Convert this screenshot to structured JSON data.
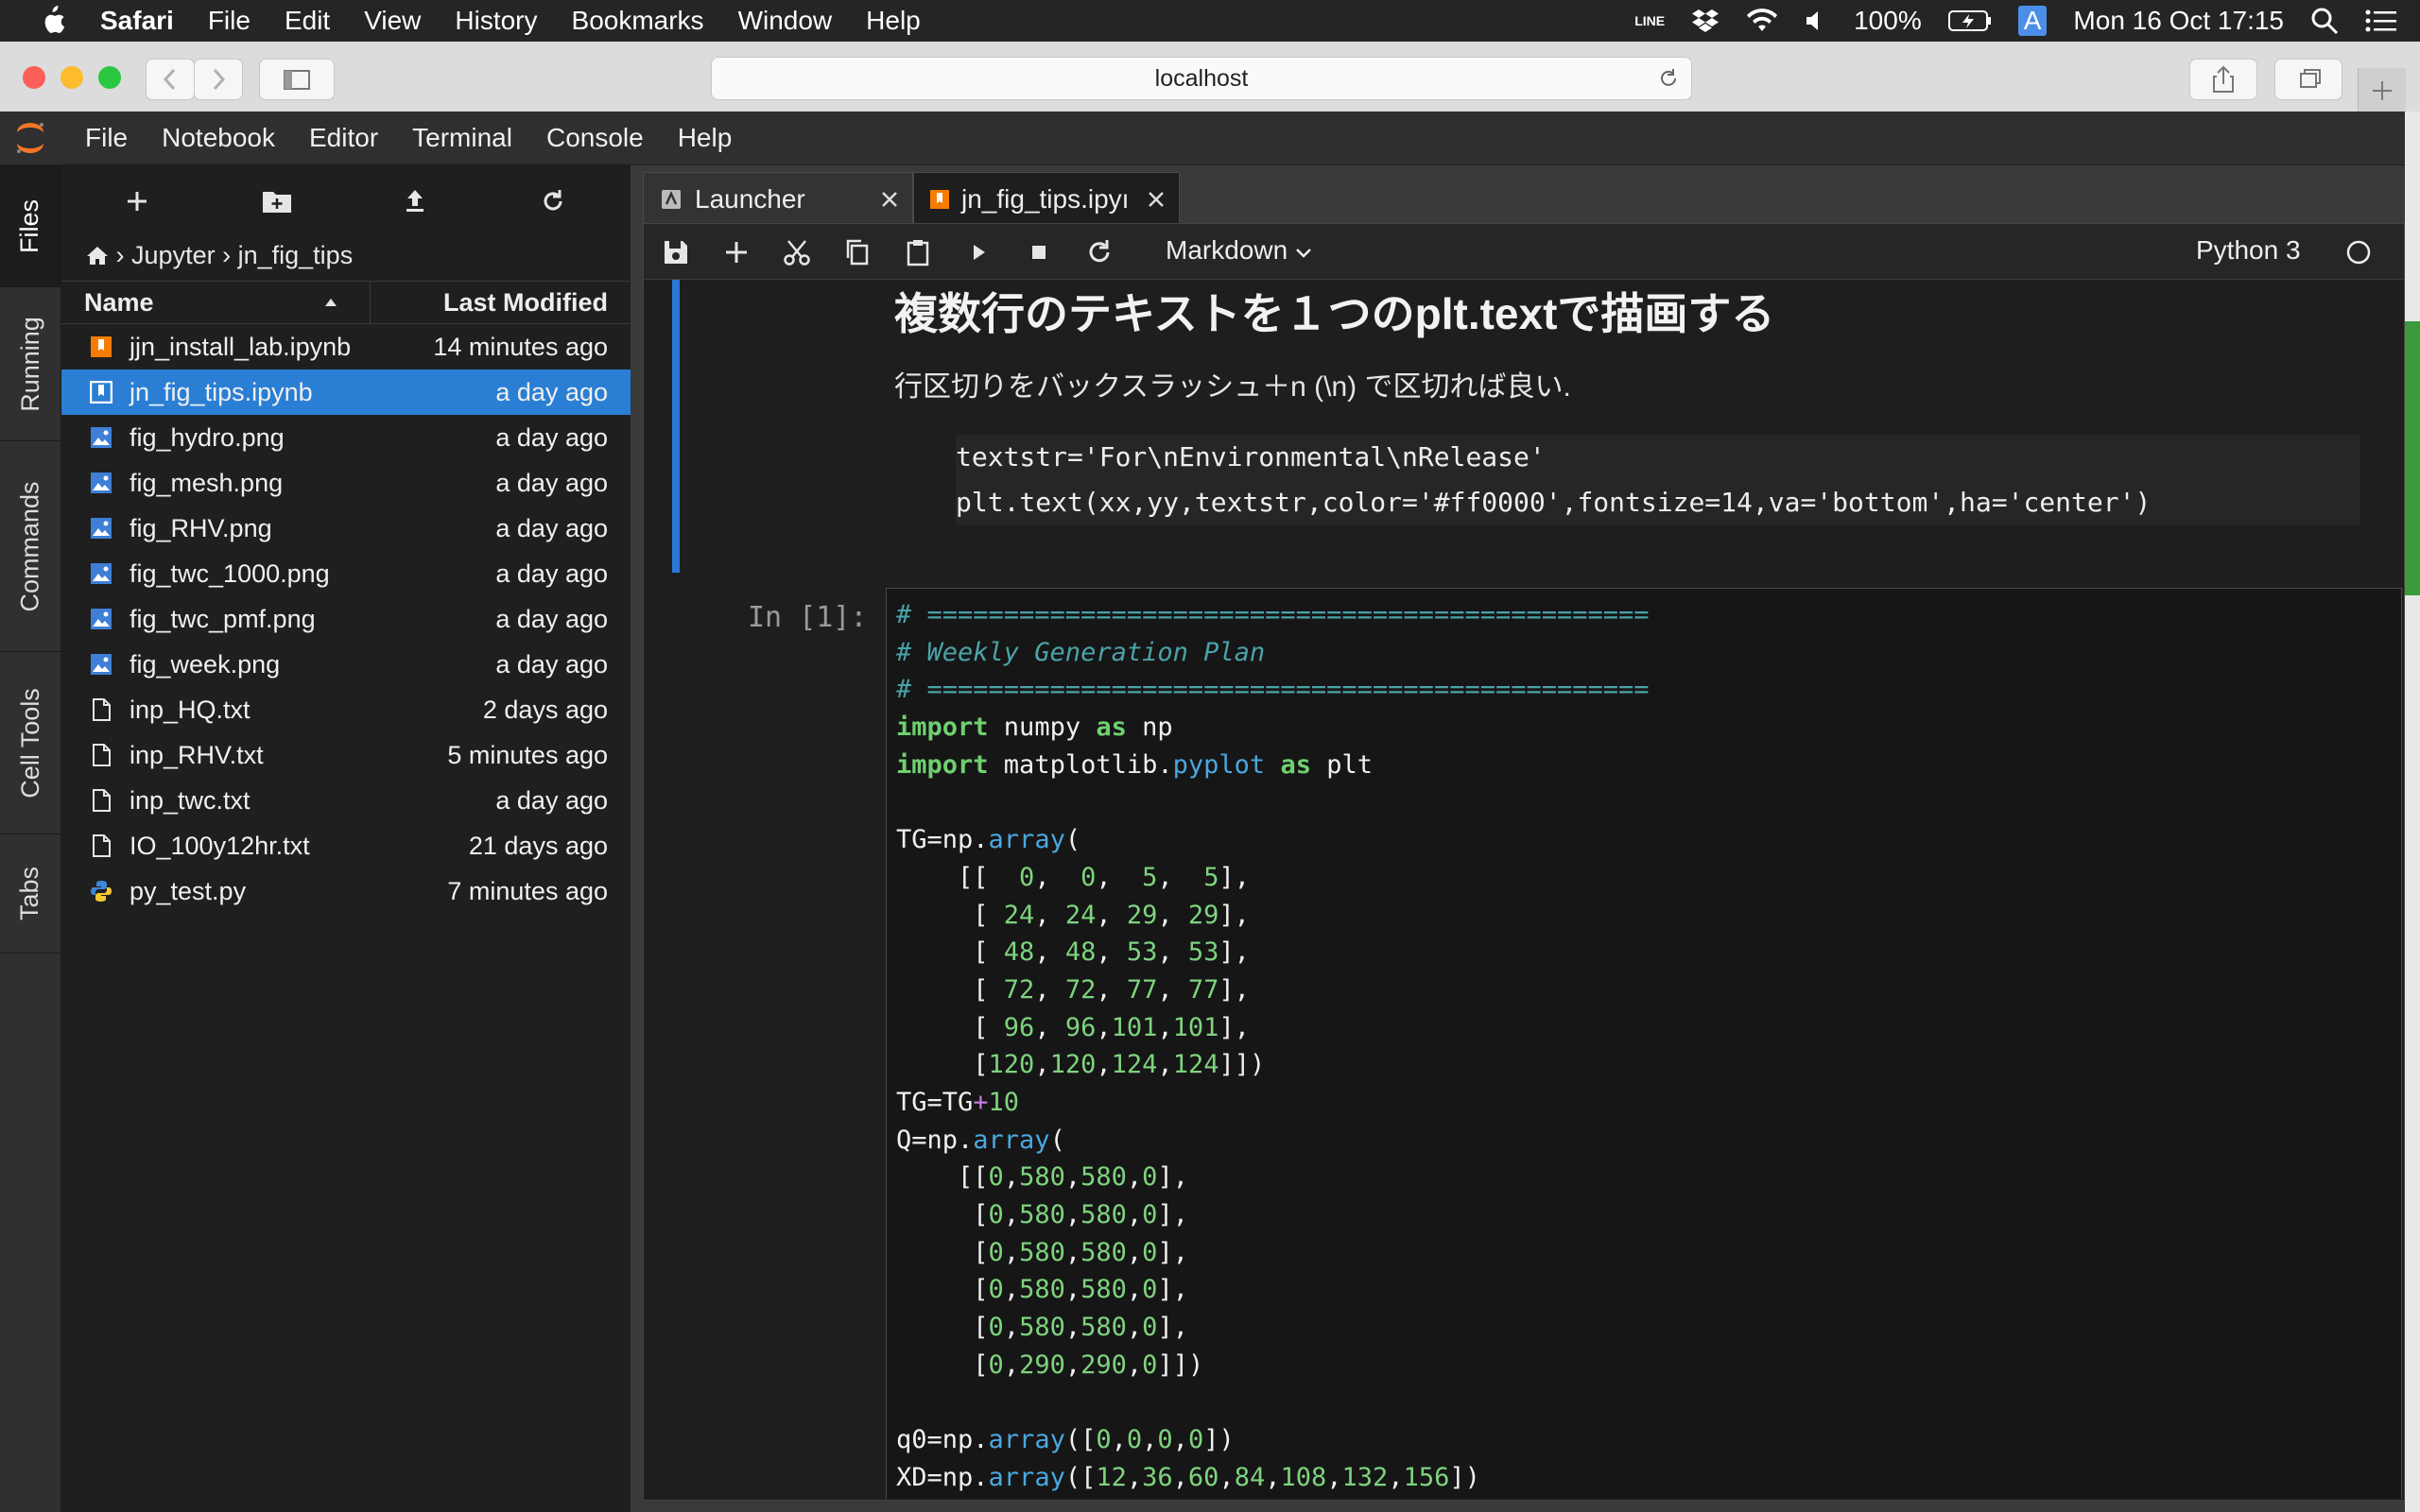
{
  "macos": {
    "app": "Safari",
    "menus": [
      "File",
      "Edit",
      "View",
      "History",
      "Bookmarks",
      "Window",
      "Help"
    ],
    "battery": "100%",
    "clock": "Mon 16 Oct  17:15",
    "line_label": "LINE",
    "input_label": "A"
  },
  "safari": {
    "url": "localhost"
  },
  "jupyter": {
    "menus": [
      "File",
      "Notebook",
      "Editor",
      "Terminal",
      "Console",
      "Help"
    ],
    "side_tabs": [
      "Files",
      "Running",
      "Commands",
      "Cell Tools",
      "Tabs"
    ],
    "breadcrumb": {
      "root": "Jupyter",
      "folder": "jn_fig_tips"
    },
    "columns": {
      "name": "Name",
      "modified": "Last Modified"
    },
    "files": [
      {
        "name": "jjn_install_lab.ipynb",
        "modified": "14 minutes ago",
        "type": "notebook"
      },
      {
        "name": "jn_fig_tips.ipynb",
        "modified": "a day ago",
        "type": "notebook",
        "selected": true
      },
      {
        "name": "fig_hydro.png",
        "modified": "a day ago",
        "type": "image"
      },
      {
        "name": "fig_mesh.png",
        "modified": "a day ago",
        "type": "image"
      },
      {
        "name": "fig_RHV.png",
        "modified": "a day ago",
        "type": "image"
      },
      {
        "name": "fig_twc_1000.png",
        "modified": "a day ago",
        "type": "image"
      },
      {
        "name": "fig_twc_pmf.png",
        "modified": "a day ago",
        "type": "image"
      },
      {
        "name": "fig_week.png",
        "modified": "a day ago",
        "type": "image"
      },
      {
        "name": "inp_HQ.txt",
        "modified": "2 days ago",
        "type": "text"
      },
      {
        "name": "inp_RHV.txt",
        "modified": "5 minutes ago",
        "type": "text"
      },
      {
        "name": "inp_twc.txt",
        "modified": "a day ago",
        "type": "text"
      },
      {
        "name": "IO_100y12hr.txt",
        "modified": "21 days ago",
        "type": "text"
      },
      {
        "name": "py_test.py",
        "modified": "7 minutes ago",
        "type": "python"
      }
    ],
    "tabs": [
      {
        "label": "Launcher"
      },
      {
        "label": "jn_fig_tips.ipyı"
      }
    ],
    "cell_type": "Markdown",
    "kernel": "Python 3",
    "markdown": {
      "title": "複数行のテキストを１つのplt.textで描画する",
      "paragraph": "行区切りをバックスラッシュ＋n (\\n) で区切れば良い.",
      "code_line1": "textstr='For\\nEnvironmental\\nRelease'",
      "code_line2": "plt.text(xx,yy,textstr,color='#ff0000',fontsize=14,va='bottom',ha='center')"
    },
    "code_prompt": "In [1]:",
    "code_lines": [
      "# ===============================================",
      "# Weekly Generation Plan",
      "# ===============================================",
      "import numpy as np",
      "import matplotlib.pyplot as plt",
      "",
      "TG=np.array(",
      "    [[  0,  0,  5,  5],",
      "     [ 24, 24, 29, 29],",
      "     [ 48, 48, 53, 53],",
      "     [ 72, 72, 77, 77],",
      "     [ 96, 96,101,101],",
      "     [120,120,124,124]])",
      "TG=TG+10",
      "Q=np.array(",
      "    [[0,580,580,0],",
      "     [0,580,580,0],",
      "     [0,580,580,0],",
      "     [0,580,580,0],",
      "     [0,580,580,0],",
      "     [0,290,290,0]])",
      "",
      "q0=np.array([0,0,0,0])",
      "XD=np.array([12,36,60,84,108,132,156])"
    ]
  }
}
